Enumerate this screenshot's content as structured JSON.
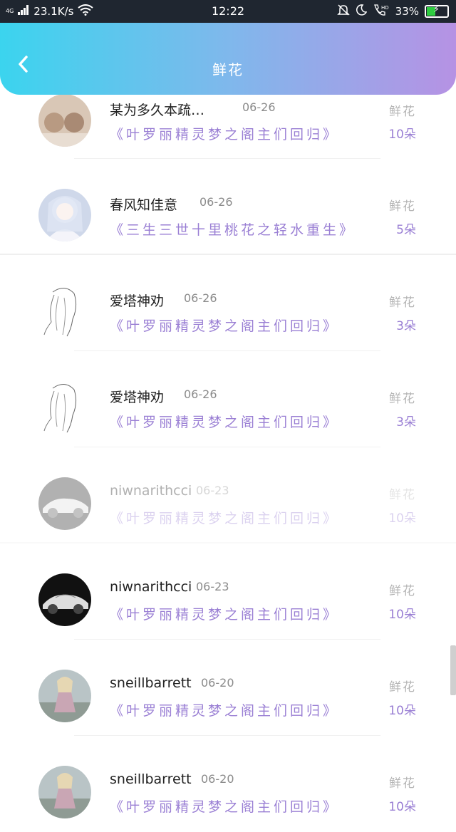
{
  "status_bar": {
    "network": "4G",
    "speed": "23.1K/s",
    "time": "12:22",
    "battery": "33%"
  },
  "header": {
    "title": "鲜花"
  },
  "gift_label": "鲜花",
  "items": [
    {
      "name": "某为多久本疏…",
      "date": "06-26",
      "book": "《叶罗丽精灵梦之阁主们回归》",
      "count": "10朵",
      "avatar": "girls-photo"
    },
    {
      "name": "春风知佳意",
      "date": "06-26",
      "book": "《三生三世十里桃花之轻水重生》",
      "count": "5朵",
      "avatar": "anime-girl"
    },
    {
      "name": "爱塔神劝",
      "date": "06-26",
      "book": "《叶罗丽精灵梦之阁主们回归》",
      "count": "3朵",
      "avatar": "sketch-girl"
    },
    {
      "name": "爱塔神劝",
      "date": "06-26",
      "book": "《叶罗丽精灵梦之阁主们回归》",
      "count": "3朵",
      "avatar": "sketch-girl"
    },
    {
      "name": "niwnarithcci",
      "date": "06-23",
      "book": "《叶罗丽精灵梦之阁主们回归》",
      "count": "10朵",
      "avatar": "car"
    },
    {
      "name": "niwnarithcci",
      "date": "06-23",
      "book": "《叶罗丽精灵梦之阁主们回归》",
      "count": "10朵",
      "avatar": "car"
    },
    {
      "name": "sneillbarrett",
      "date": "06-20",
      "book": "《叶罗丽精灵梦之阁主们回归》",
      "count": "10朵",
      "avatar": "blonde-girl"
    },
    {
      "name": "sneillbarrett",
      "date": "06-20",
      "book": "《叶罗丽精灵梦之阁主们回归》",
      "count": "10朵",
      "avatar": "blonde-girl"
    }
  ],
  "colors": {
    "header_start": "#3bd4ee",
    "header_end": "#b692e4",
    "book_title": "#9a7fd4",
    "label": "#b5b5b5"
  }
}
